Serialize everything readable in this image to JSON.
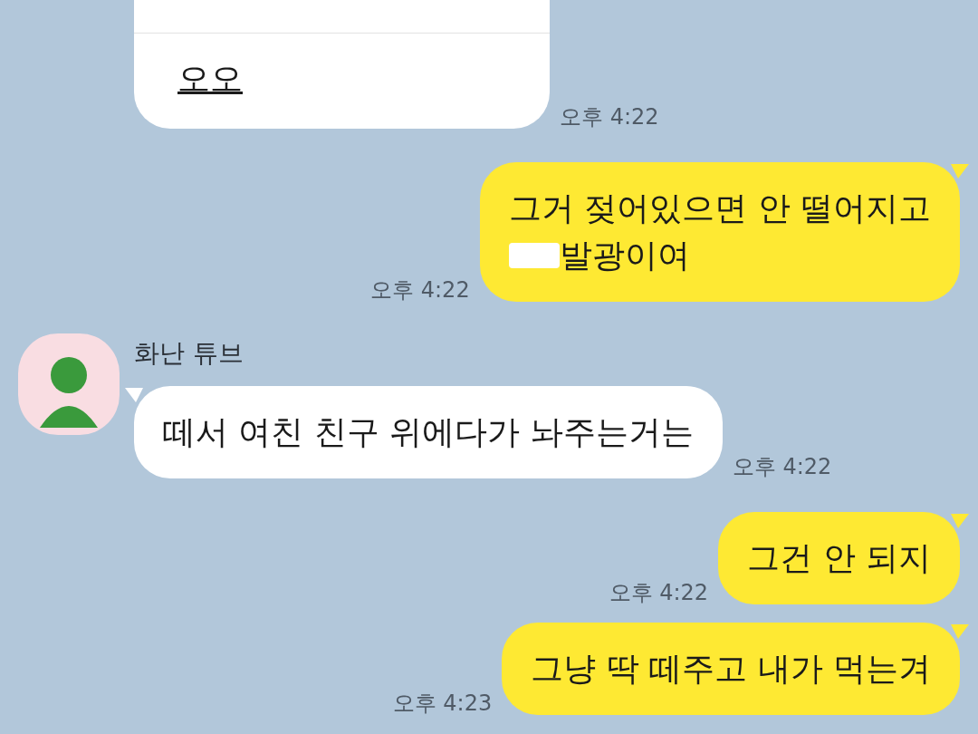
{
  "messages": [
    {
      "kind": "received_link",
      "lines": [
        {
          "text": "오오"
        }
      ],
      "time": "오후 4:22"
    },
    {
      "kind": "sent",
      "lines": [
        {
          "text": "그거 젖어있으면 안 떨어지고"
        },
        {
          "text": "발광이여",
          "redacted": true
        }
      ],
      "time": "오후 4:22"
    },
    {
      "kind": "received",
      "name": "화난 튜브",
      "lines": [
        {
          "text": "떼서 여친 친구 위에다가 놔주는거는"
        }
      ],
      "time": "오후 4:22"
    },
    {
      "kind": "sent",
      "lines": [
        {
          "text": "그건 안 되지"
        }
      ],
      "time": "오후 4:22"
    },
    {
      "kind": "sent",
      "lines": [
        {
          "text": "그냥 딱 떼주고 내가 먹는겨"
        }
      ],
      "time": "오후 4:23"
    }
  ]
}
